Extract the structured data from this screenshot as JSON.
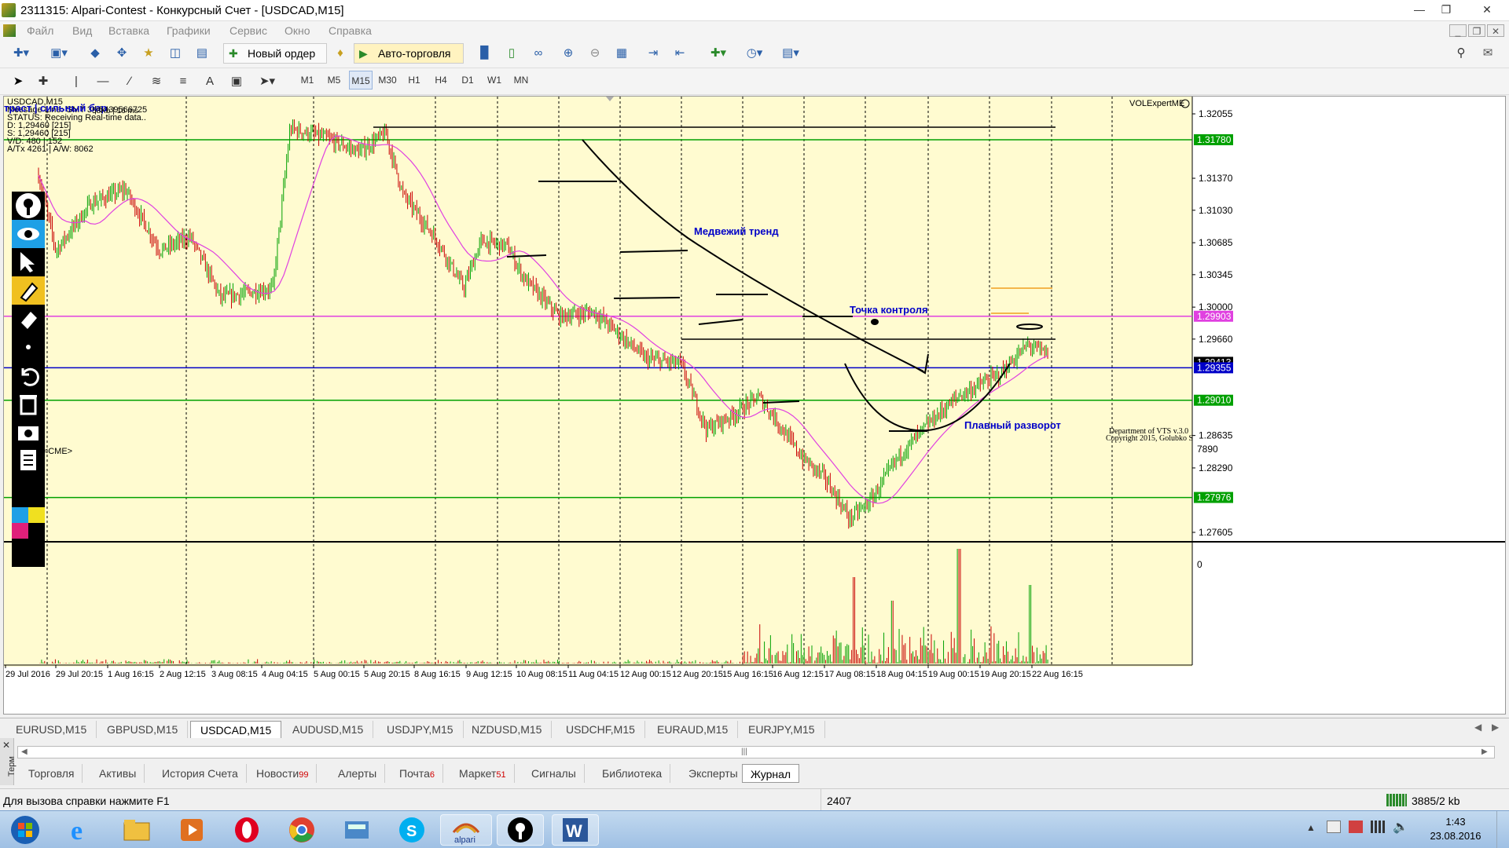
{
  "window": {
    "title": "2311315: Alpari-Contest - Конкурсный Счет - [USDCAD,M15]"
  },
  "menu": [
    "Файл",
    "Вид",
    "Вставка",
    "Графики",
    "Сервис",
    "Окно",
    "Справка"
  ],
  "toolbar": {
    "new_order": "Новый ордер",
    "auto_trading": "Авто-торговля"
  },
  "timeframes": [
    "M1",
    "M5",
    "M15",
    "M30",
    "H1",
    "H4",
    "D1",
    "W1",
    "MN"
  ],
  "active_timeframe": "M15",
  "chart": {
    "symbol_header": "USDCAD,M15",
    "message_line": "Message Line: GMT 3 | 5439566725",
    "status_line": "STATUS: Receiving Real-time data..",
    "d_line": "D: 1,29460 [215]",
    "s_line": "S: 1,29460 [215]",
    "v_line": "V/D: 480 | 152",
    "a_line": "A/Tx 4261 | A/W: 8062",
    "overlay_partial": "траст | сильный бар",
    "overlay_extra": "58Kb | 16 ms",
    "indicator_name": "VOLExpertME",
    "volume_label": "A <CME>",
    "copyright_1": "Department of VTS  v.3.0",
    "copyright_2": "Copyright 2015, Golubko S",
    "annotations": {
      "bear_trend": "Медвежий тренд",
      "control_point": "Точка контроля",
      "smooth_reversal": "Плавный разворот"
    },
    "price_ticks": [
      "1.32055",
      "1.31370",
      "1.31030",
      "1.30685",
      "1.30345",
      "1.30000",
      "1.29660",
      "1.28635",
      "1.28290",
      "1.27605"
    ],
    "price_highlights": [
      {
        "label": "1.31780",
        "color": "#00a000"
      },
      {
        "label": "1.29903",
        "color": "#e040e0"
      },
      {
        "label": "1.29413",
        "color": "#000000"
      },
      {
        "label": "1.29355",
        "color": "#0000c8"
      },
      {
        "label": "1.29010",
        "color": "#00a000"
      },
      {
        "label": "1.27976",
        "color": "#00a000"
      }
    ],
    "volume_ticks": [
      "7890",
      "0"
    ],
    "time_ticks": [
      "29 Jul 2016",
      "29 Jul 20:15",
      "1 Aug 16:15",
      "2 Aug 12:15",
      "3 Aug 08:15",
      "4 Aug 04:15",
      "5 Aug 00:15",
      "5 Aug 20:15",
      "8 Aug 16:15",
      "9 Aug 12:15",
      "10 Aug 08:15",
      "11 Aug 04:15",
      "12 Aug 00:15",
      "12 Aug 20:15",
      "15 Aug 16:15",
      "16 Aug 12:15",
      "17 Aug 08:15",
      "18 Aug 04:15",
      "19 Aug 00:15",
      "19 Aug 20:15",
      "22 Aug 16:15"
    ],
    "colors": {
      "background": "#fffbd0",
      "bull": "#00a000",
      "bear": "#c80000",
      "ma": "#e040e0"
    }
  },
  "symbol_tabs": [
    "EURUSD,M15",
    "GBPUSD,M15",
    "USDCAD,M15",
    "AUDUSD,M15",
    "USDJPY,M15",
    "NZDUSD,M15",
    "USDCHF,M15",
    "EURAUD,M15",
    "EURJPY,M15"
  ],
  "active_symbol_tab": "USDCAD,M15",
  "terminal": {
    "side_label": "Терм",
    "tabs": [
      {
        "label": "Торговля",
        "badge": ""
      },
      {
        "label": "Активы",
        "badge": ""
      },
      {
        "label": "История Счета",
        "badge": ""
      },
      {
        "label": "Новости",
        "badge": "99"
      },
      {
        "label": "Алерты",
        "badge": ""
      },
      {
        "label": "Почта",
        "badge": "6"
      },
      {
        "label": "Маркет",
        "badge": "51"
      },
      {
        "label": "Сигналы",
        "badge": ""
      },
      {
        "label": "Библиотека",
        "badge": ""
      },
      {
        "label": "Эксперты",
        "badge": ""
      },
      {
        "label": "Журнал",
        "badge": ""
      }
    ],
    "active_tab": "Журнал"
  },
  "status": {
    "help": "Для вызова справки нажмите F1",
    "count": "2407",
    "traffic": "3885/2 kb"
  },
  "taskbar": {
    "apps": [
      "windows-start",
      "internet-explorer",
      "file-explorer",
      "media-player",
      "opera",
      "chrome",
      "control-panel",
      "skype",
      "alpari",
      "metatrader",
      "word"
    ],
    "alpari_label": "alpari",
    "time": "1:43",
    "date": "23.08.2016"
  }
}
